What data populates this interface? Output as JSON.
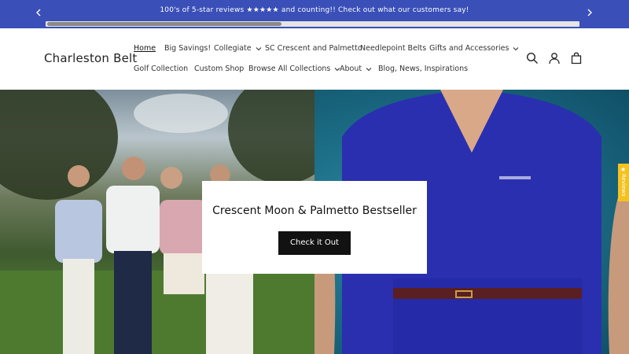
{
  "announcement": {
    "text": "100's of 5-star reviews ★★★★★ and counting!! Check out what our customers say!",
    "prev_icon": "chevron-left-icon",
    "next_icon": "chevron-right-icon"
  },
  "header": {
    "logo": "Charleston Belt",
    "nav": [
      {
        "label": "Home",
        "active": true
      },
      {
        "label": "Big Savings!"
      },
      {
        "label": "Collegiate",
        "dropdown": true
      },
      {
        "label": "SC Crescent and Palmetto"
      },
      {
        "label": "Needlepoint Belts"
      },
      {
        "label": "Gifts and Accessories",
        "dropdown": true
      },
      {
        "label": "Golf Collection"
      },
      {
        "label": "Custom Shop"
      },
      {
        "label": "Browse All Collections",
        "dropdown": true
      },
      {
        "label": "About",
        "dropdown": true
      },
      {
        "label": "Blog, News, Inspirations"
      }
    ],
    "icons": [
      "search-icon",
      "account-icon",
      "cart-icon"
    ]
  },
  "hero": {
    "title": "Crescent Moon & Palmetto Bestseller",
    "button": "Check it Out"
  },
  "reviews_tab": {
    "label": "Reviews",
    "color": "#f4c21f"
  },
  "colors": {
    "announcement_bg": "#3a4fb7",
    "button_bg": "#121212"
  }
}
